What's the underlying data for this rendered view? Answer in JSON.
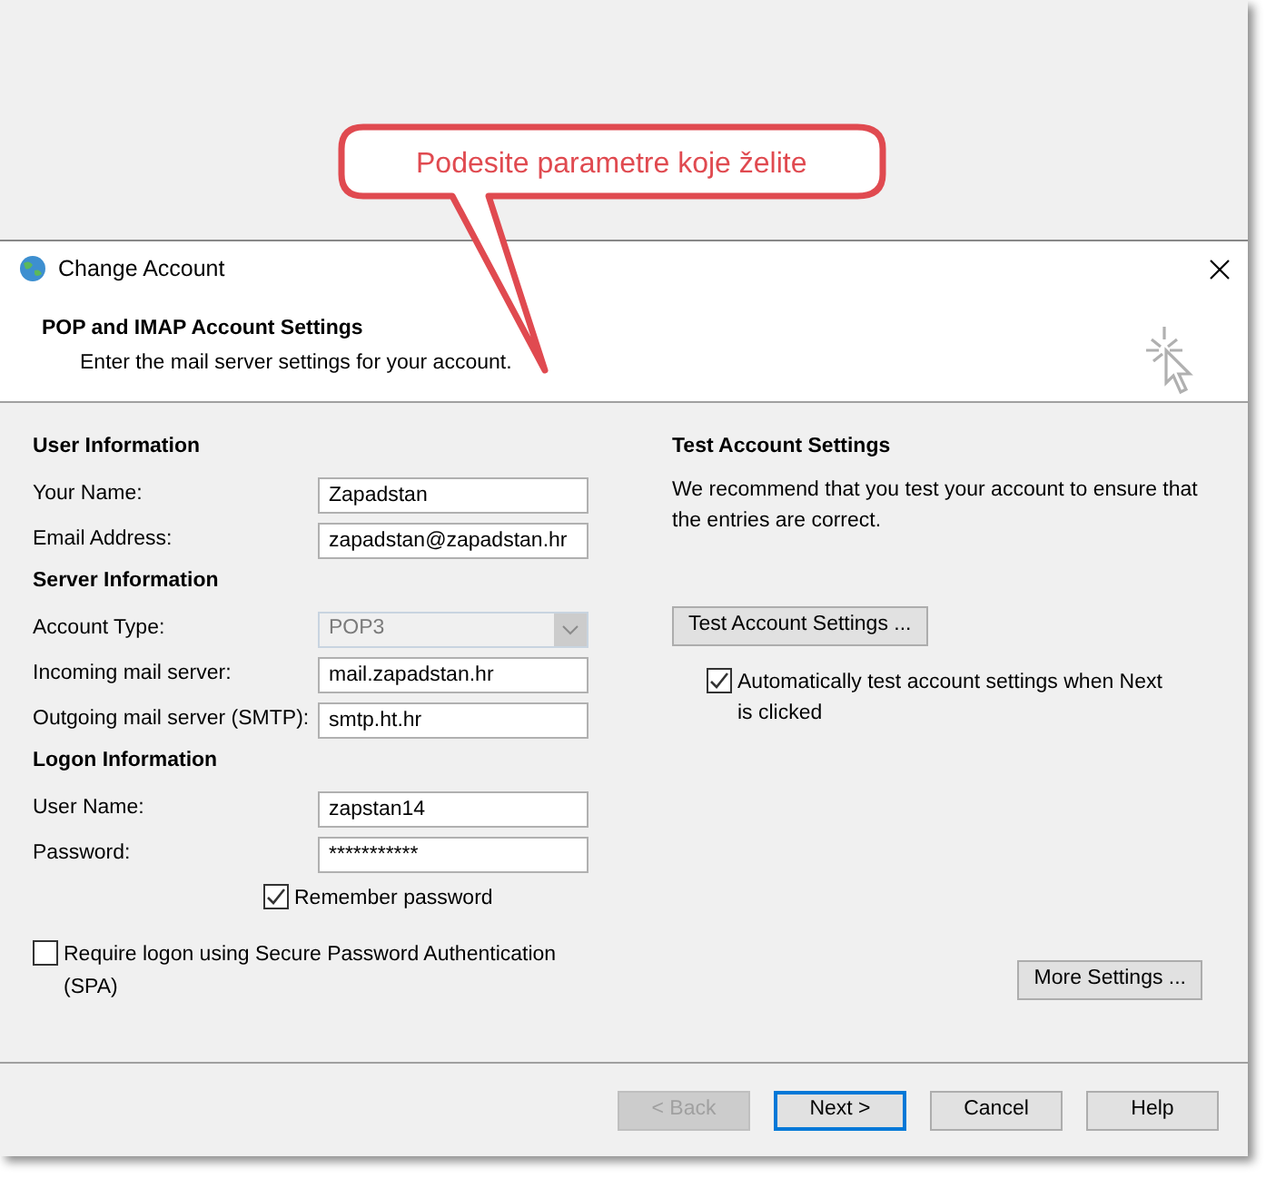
{
  "callout": {
    "text": "Podesite parametre koje želite"
  },
  "window": {
    "title": "Change Account"
  },
  "header": {
    "title": "POP and IMAP Account Settings",
    "subtitle": "Enter the mail server settings for your account."
  },
  "sections": [
    {
      "heading": "User Information",
      "fields": [
        {
          "label": "Your Name:",
          "kind": "text",
          "value": "Zapadstan",
          "disabled": false
        },
        {
          "label": "Email Address:",
          "kind": "text",
          "value": "zapadstan@zapadstan.hr",
          "disabled": false
        }
      ]
    },
    {
      "heading": "Server Information",
      "fields": [
        {
          "label": "Account Type:",
          "kind": "select",
          "value": "POP3",
          "disabled": true
        },
        {
          "label": "Incoming mail server:",
          "kind": "text",
          "value": "mail.zapadstan.hr",
          "disabled": false
        },
        {
          "label": "Outgoing mail server (SMTP):",
          "kind": "text",
          "value": "smtp.ht.hr",
          "disabled": false
        }
      ]
    },
    {
      "heading": "Logon Information",
      "fields": [
        {
          "label": "User Name:",
          "kind": "text",
          "value": "zapstan14",
          "disabled": false
        },
        {
          "label": "Password:",
          "kind": "text",
          "value": "***********",
          "disabled": false
        }
      ]
    }
  ],
  "remember_password": {
    "label": "Remember password",
    "checked": true
  },
  "spa": {
    "label": "Require logon using Secure Password Authentication (SPA)",
    "checked": false
  },
  "test": {
    "heading": "Test Account Settings",
    "description": "We recommend that you test your account to ensure that the entries are correct.",
    "button": "Test Account Settings ...",
    "auto_test": {
      "label": "Automatically test account settings when Next is clicked",
      "checked": true
    }
  },
  "more_settings": "More Settings ...",
  "buttons": [
    {
      "label": "< Back",
      "disabled": true,
      "default": false
    },
    {
      "label": "Next >",
      "disabled": false,
      "default": true
    },
    {
      "label": "Cancel",
      "disabled": false,
      "default": false
    },
    {
      "label": "Help",
      "disabled": false,
      "default": false
    }
  ]
}
